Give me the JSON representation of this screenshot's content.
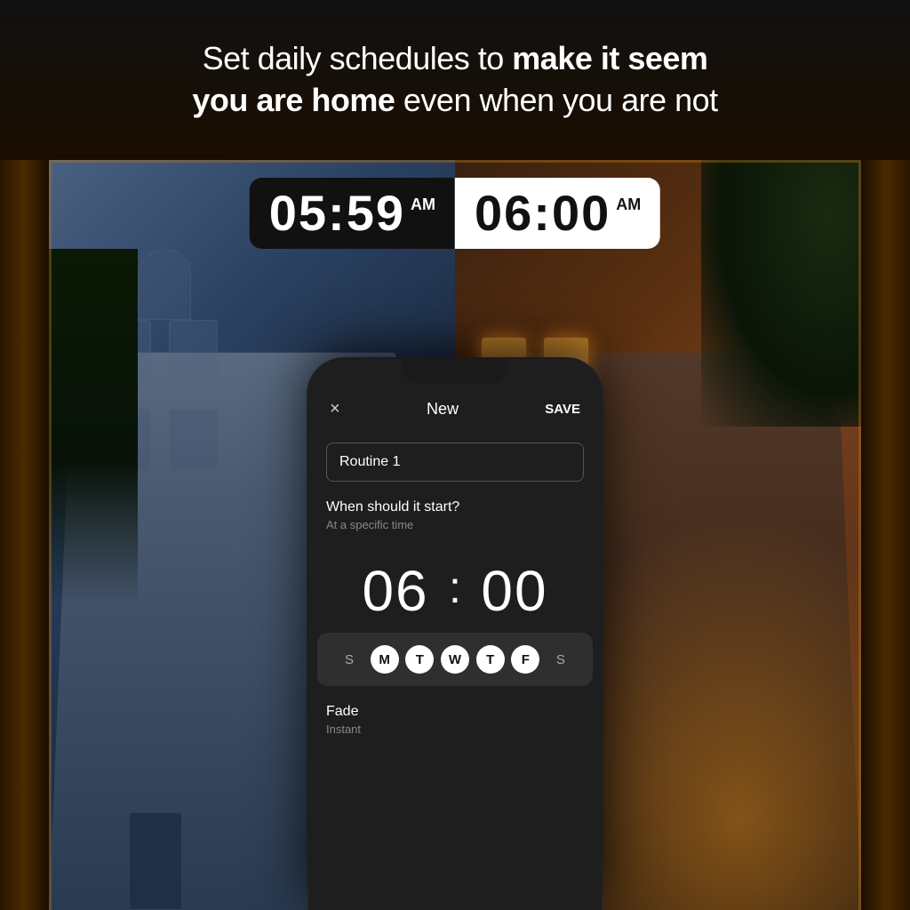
{
  "header": {
    "line1_normal": "Set daily schedules to ",
    "line1_bold": "make it seem",
    "line2_bold": "you are home",
    "line2_normal": " even when you are not"
  },
  "clock": {
    "left_time": "05:59",
    "left_ampm": "AM",
    "right_time": "06:00",
    "right_ampm": "AM"
  },
  "phone": {
    "close_icon": "×",
    "title": "New",
    "save_label": "SAVE",
    "routine_name_placeholder": "Routine 1",
    "routine_name_value": "Routine 1",
    "when_title": "When should it start?",
    "when_subtitle": "At a specific time",
    "time_hour": "06",
    "time_minute": "00",
    "days": [
      "S",
      "M",
      "T",
      "W",
      "T",
      "F",
      "S"
    ],
    "active_days": [
      1,
      2,
      3,
      4,
      5
    ],
    "fade_title": "Fade",
    "fade_subtitle": "Instant"
  }
}
